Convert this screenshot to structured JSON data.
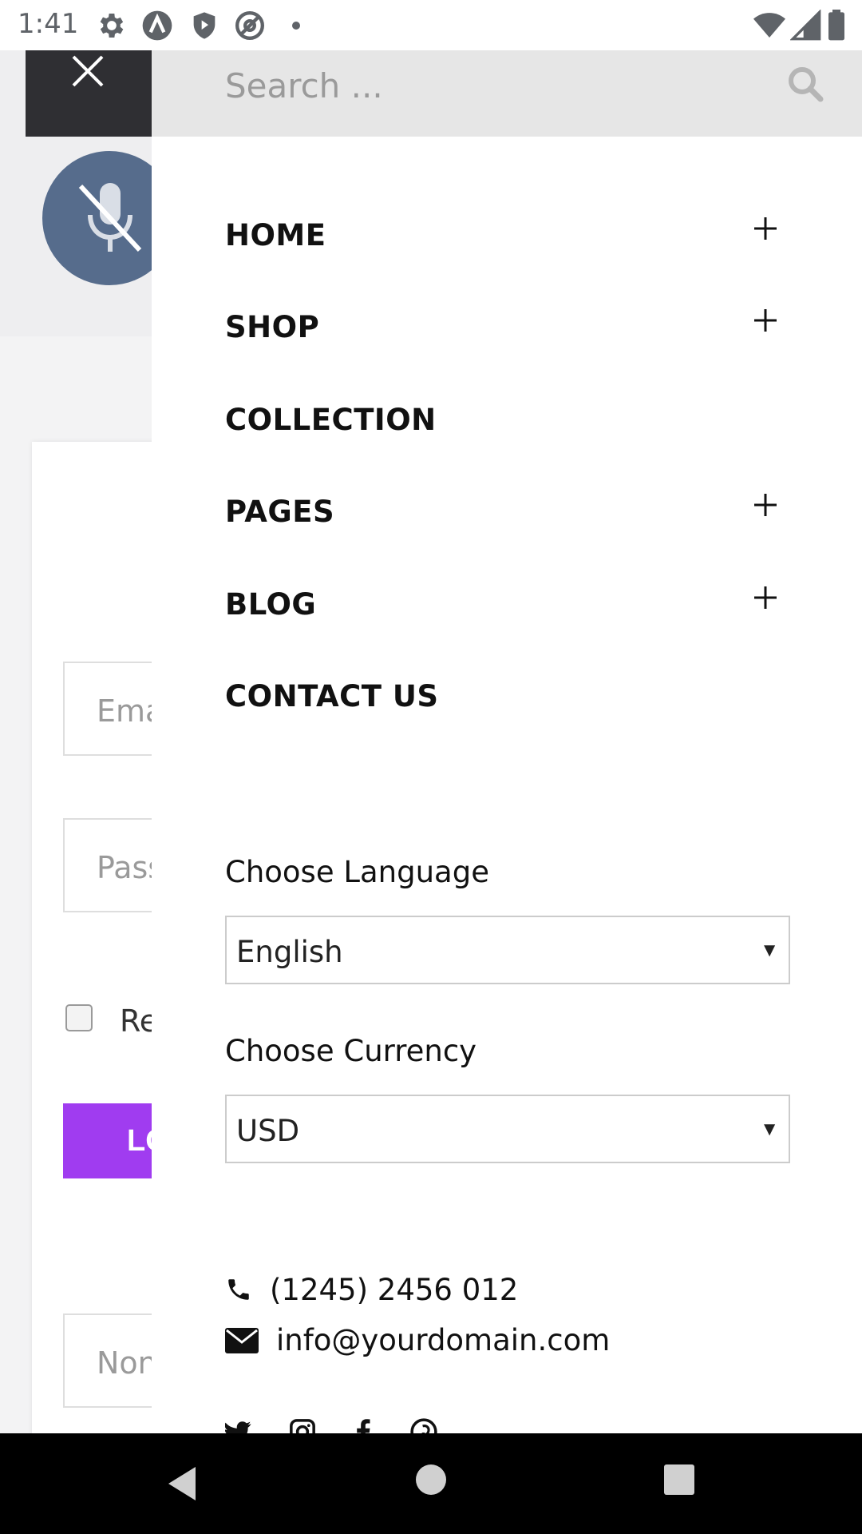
{
  "status_bar": {
    "time": "1:41",
    "icons": [
      "settings-icon",
      "a-icon",
      "shield-icon",
      "at-sign-icon",
      "dot-icon",
      "wifi-icon",
      "signal-icon",
      "battery-icon"
    ]
  },
  "search": {
    "placeholder": "Search ..."
  },
  "background_page": {
    "email_placeholder": "Ema",
    "password_placeholder": "Pass",
    "remember_label": "Re",
    "login_label": "LO",
    "extra_field": "Non",
    "accent_color": "#a03cf0"
  },
  "menu": {
    "items": [
      {
        "label": "HOME",
        "expandable": true
      },
      {
        "label": "SHOP",
        "expandable": true
      },
      {
        "label": "COLLECTION",
        "expandable": false
      },
      {
        "label": "PAGES",
        "expandable": true
      },
      {
        "label": "BLOG",
        "expandable": true
      },
      {
        "label": "CONTACT US",
        "expandable": false
      }
    ]
  },
  "language": {
    "label": "Choose Language",
    "selected": "English"
  },
  "currency": {
    "label": "Choose Currency",
    "selected": "USD"
  },
  "contact": {
    "phone": "(1245) 2456 012",
    "email": "info@yourdomain.com"
  },
  "social": [
    "twitter-icon",
    "instagram-icon",
    "facebook-icon",
    "pinterest-icon"
  ],
  "colors": {
    "drawer_bg": "#ffffff",
    "search_bg": "#e6e6e6",
    "close_bg": "#2f2f33",
    "mic_bg": "#566c8c"
  }
}
